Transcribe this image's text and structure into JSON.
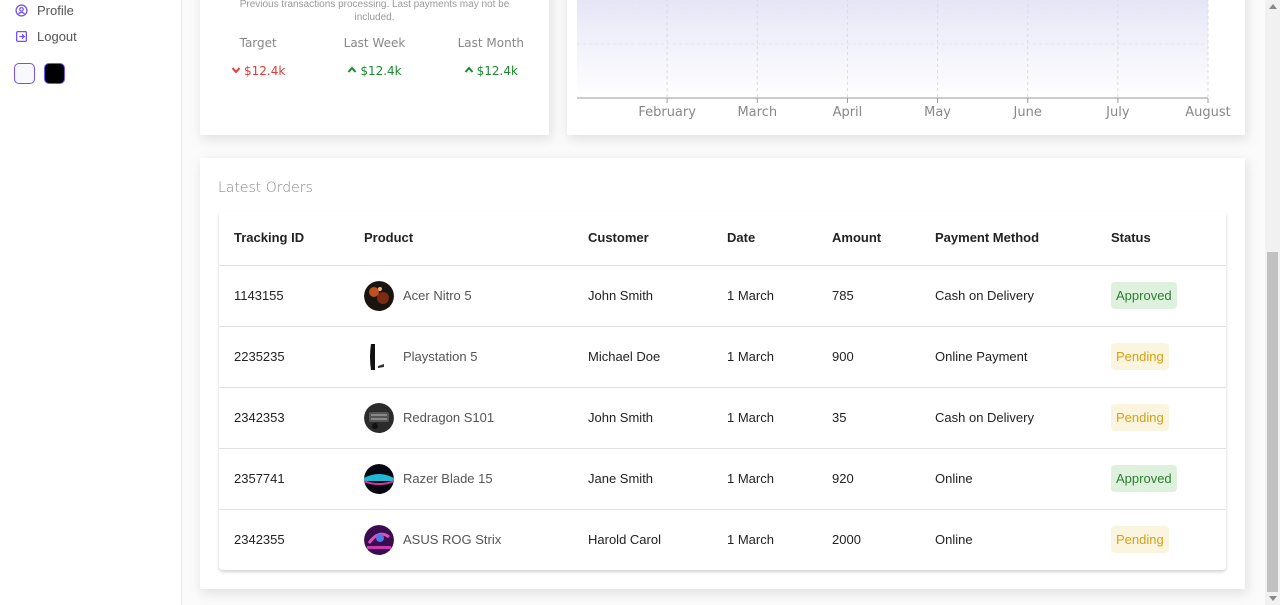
{
  "sidebar": {
    "items": [
      {
        "label": "Profile",
        "icon": "account-circle-icon"
      },
      {
        "label": "Logout",
        "icon": "exit-icon"
      }
    ],
    "themes": [
      "light",
      "dark"
    ],
    "accent": "#7451f8"
  },
  "featured": {
    "description": "Previous transactions processing. Last payments may not be included.",
    "items": [
      {
        "title": "Target",
        "value": "$12.4k",
        "trend": "down"
      },
      {
        "title": "Last Week",
        "value": "$12.4k",
        "trend": "up"
      },
      {
        "title": "Last Month",
        "value": "$12.4k",
        "trend": "up"
      }
    ]
  },
  "chart_data": {
    "type": "area",
    "x": [
      "February",
      "March",
      "April",
      "May",
      "June",
      "July",
      "August"
    ],
    "fill_color": "#8884d8",
    "grid": true
  },
  "orders": {
    "title": "Latest Orders",
    "columns": [
      "Tracking ID",
      "Product",
      "Customer",
      "Date",
      "Amount",
      "Payment Method",
      "Status"
    ],
    "rows": [
      {
        "id": "1143155",
        "product": "Acer Nitro 5",
        "customer": "John Smith",
        "date": "1 March",
        "amount": "785",
        "method": "Cash on Delivery",
        "status": "Approved"
      },
      {
        "id": "2235235",
        "product": "Playstation 5",
        "customer": "Michael Doe",
        "date": "1 March",
        "amount": "900",
        "method": "Online Payment",
        "status": "Pending"
      },
      {
        "id": "2342353",
        "product": "Redragon S101",
        "customer": "John Smith",
        "date": "1 March",
        "amount": "35",
        "method": "Cash on Delivery",
        "status": "Pending"
      },
      {
        "id": "2357741",
        "product": "Razer Blade 15",
        "customer": "Jane Smith",
        "date": "1 March",
        "amount": "920",
        "method": "Online",
        "status": "Approved"
      },
      {
        "id": "2342355",
        "product": "ASUS ROG Strix",
        "customer": "Harold Carol",
        "date": "1 March",
        "amount": "2000",
        "method": "Online",
        "status": "Pending"
      }
    ]
  }
}
